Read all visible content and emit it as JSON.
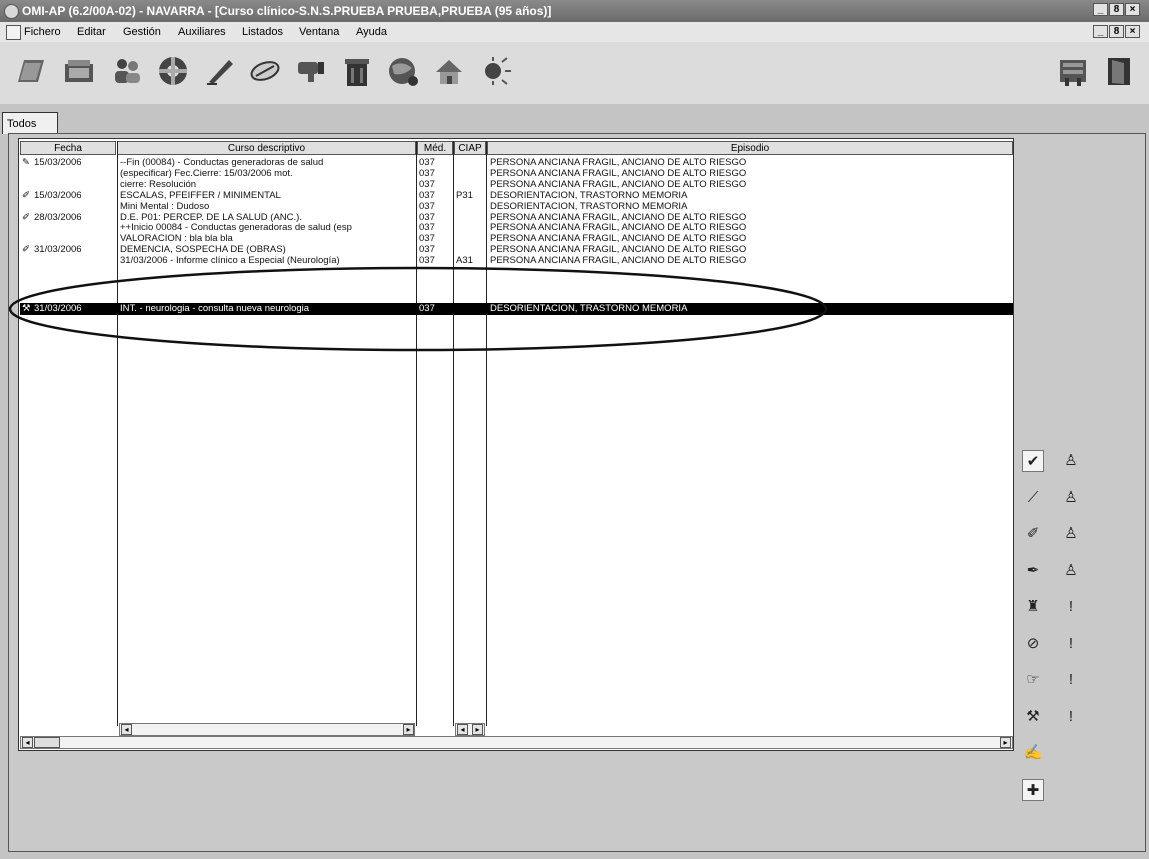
{
  "window": {
    "title": "OMI-AP (6.2/00A-02) - NAVARRA - [Curso clínico-S.N.S.PRUEBA PRUEBA,PRUEBA (95 años)]",
    "controls": [
      "_",
      "8",
      "×"
    ]
  },
  "menu": [
    "Fichero",
    "Editar",
    "Gestión",
    "Auxiliares",
    "Listados",
    "Ventana",
    "Ayuda"
  ],
  "toolbar": {
    "icons": [
      "folder-icon",
      "open-box-icon",
      "users-icon",
      "lifebuoy-icon",
      "pen-icon",
      "pill-icon",
      "thumbs-down-icon",
      "trash-icon",
      "globe-icon",
      "house-icon",
      "sun-icon"
    ],
    "right_icons": [
      "server-icon",
      "door-icon"
    ]
  },
  "tabs": [
    {
      "label": "Todos",
      "active": true
    }
  ],
  "table": {
    "columns": [
      "Fecha",
      "Curso descriptivo",
      "Méd.",
      "CIAP",
      "Episodio"
    ],
    "rows": [
      {
        "fecha": "15/03/2006",
        "icon": "pen",
        "curso": "--Fin (00084) - Conductas generadoras de salud",
        "med": "037",
        "ciap": "",
        "episodio": "PERSONA ANCIANA FRAGIL, ANCIANO DE ALTO RIESGO"
      },
      {
        "fecha": "",
        "icon": "",
        "curso": "(especificar) Fec.Cierre: 15/03/2006 mot.",
        "med": "037",
        "ciap": "",
        "episodio": "PERSONA ANCIANA FRAGIL, ANCIANO DE ALTO RIESGO"
      },
      {
        "fecha": "",
        "icon": "",
        "curso": "cierre: Resolución",
        "med": "037",
        "ciap": "",
        "episodio": "PERSONA ANCIANA FRAGIL, ANCIANO DE ALTO RIESGO"
      },
      {
        "fecha": "15/03/2006",
        "icon": "pencil",
        "curso": "ESCALAS, PFEIFFER / MINIMENTAL",
        "med": "037",
        "ciap": "P31",
        "episodio": "DESORIENTACION, TRASTORNO MEMORIA"
      },
      {
        "fecha": "",
        "icon": "",
        "curso": "Mini Mental : Dudoso",
        "med": "037",
        "ciap": "",
        "episodio": "DESORIENTACION, TRASTORNO MEMORIA"
      },
      {
        "fecha": "28/03/2006",
        "icon": "pencil",
        "curso": "D.E. P01: PERCEP. DE LA SALUD (ANC.).",
        "med": "037",
        "ciap": "",
        "episodio": "PERSONA ANCIANA FRAGIL, ANCIANO DE ALTO RIESGO"
      },
      {
        "fecha": "",
        "icon": "",
        "curso": "++Inicio 00084 - Conductas generadoras de salud (esp",
        "med": "037",
        "ciap": "",
        "episodio": "PERSONA ANCIANA FRAGIL, ANCIANO DE ALTO RIESGO"
      },
      {
        "fecha": "",
        "icon": "",
        "curso": "VALORACION : bla bla bla",
        "med": "037",
        "ciap": "",
        "episodio": "PERSONA ANCIANA FRAGIL, ANCIANO DE ALTO RIESGO"
      },
      {
        "fecha": "31/03/2006",
        "icon": "pencil",
        "curso": "DEMENCIA, SOSPECHA DE (OBRAS)",
        "med": "037",
        "ciap": "",
        "episodio": "PERSONA ANCIANA FRAGIL, ANCIANO DE ALTO RIESGO"
      },
      {
        "fecha": "",
        "icon": "",
        "curso": "31/03/2006 - Informe clínico a Especial (Neurología)",
        "med": "037",
        "ciap": "A31",
        "episodio": "PERSONA ANCIANA FRAGIL, ANCIANO DE ALTO RIESGO"
      },
      {
        "fecha": "31/03/2006",
        "icon": "tools",
        "curso": "INT. - neurologia - consulta nueva neurologia",
        "med": "037",
        "ciap": "",
        "episodio": "DESORIENTACION, TRASTORNO MEMORIA",
        "selected": true
      }
    ]
  },
  "side_buttons": [
    {
      "left": "check-icon",
      "right": "microscope-icon"
    },
    {
      "left": "pen-icon",
      "right": "microscope-icon"
    },
    {
      "left": "pencil-icon",
      "right": "microscope-icon"
    },
    {
      "left": "pen-nib-icon",
      "right": "microscope-icon"
    },
    {
      "left": "puzzle-icon",
      "right": "exclamation-icon"
    },
    {
      "left": "pill-icon",
      "right": "exclamation-icon"
    },
    {
      "left": "hand-icon",
      "right": "exclamation-icon"
    },
    {
      "left": "tools-icon",
      "right": "exclamation-icon"
    },
    {
      "left": "quill-icon",
      "right": ""
    },
    {
      "left": "plus-icon",
      "right": ""
    }
  ]
}
